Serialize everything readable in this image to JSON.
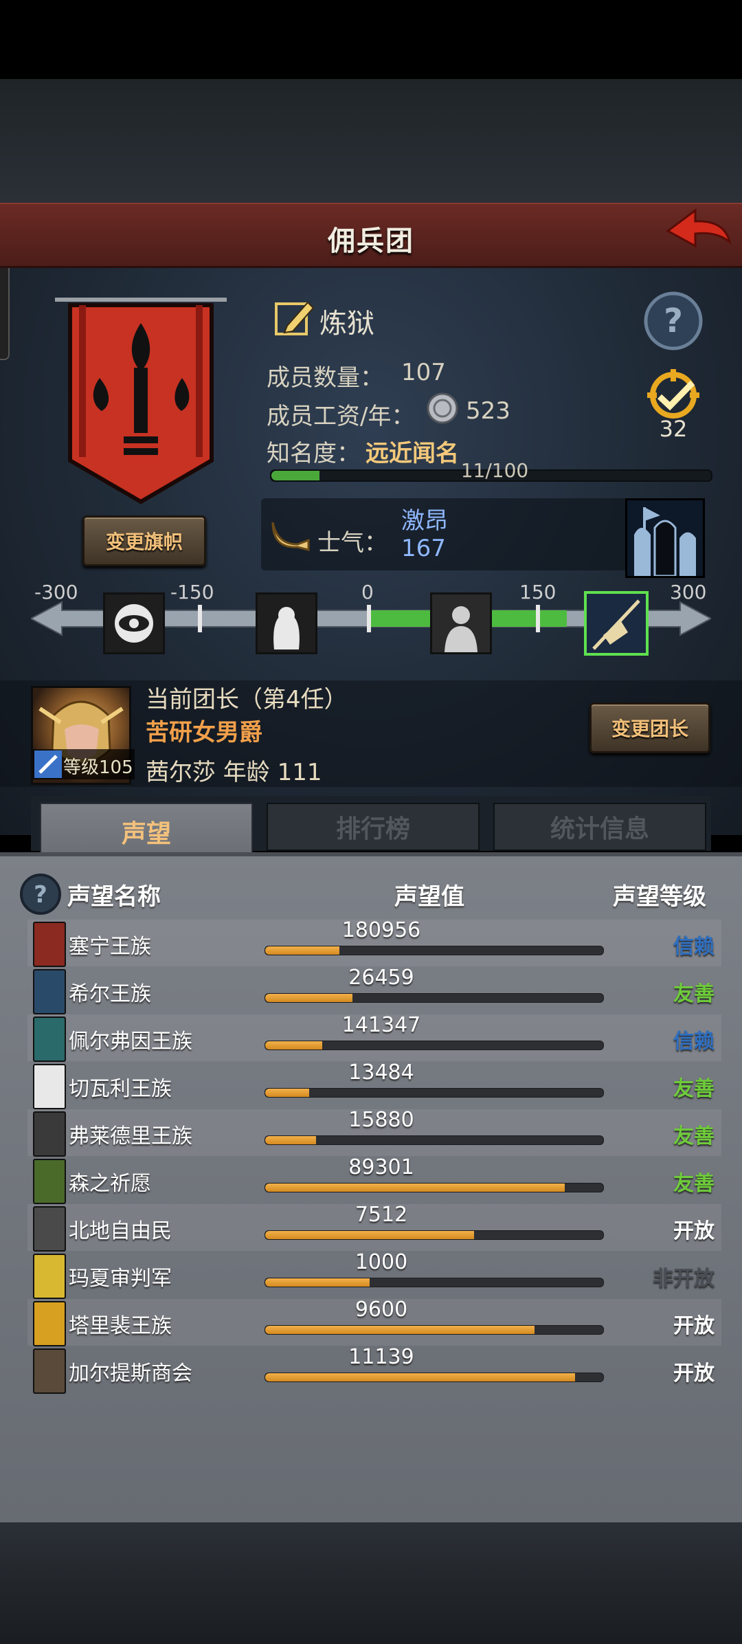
{
  "header": {
    "title": "佣兵团"
  },
  "guild": {
    "name": "炼狱",
    "members_label": "成员数量：",
    "members_value": "107",
    "wage_label": "成员工资/年：",
    "wage_value": "523",
    "fame_label": "知名度：",
    "fame_value": "远近闻名",
    "fame_progress_text": "11/100",
    "fame_progress_fraction": 0.11,
    "target_count": "32",
    "change_banner_label": "变更旗帜",
    "morale_label": "士气：",
    "morale_state": "激昂",
    "morale_value": "167"
  },
  "morale_scale": {
    "ticks": [
      "-300",
      "-150",
      "0",
      "150",
      "300"
    ],
    "value": 167,
    "range": [
      -300,
      300
    ]
  },
  "leader": {
    "title": "当前团长（第4任）",
    "trait": "苦研女男爵",
    "level_label": "等级105",
    "name_age": "茜尔莎  年龄  111",
    "change_label": "变更团长"
  },
  "tabs": [
    "声望",
    "排行榜",
    "统计信息"
  ],
  "reputation": {
    "headers": {
      "name": "声望名称",
      "value": "声望值",
      "level": "声望等级"
    },
    "rows": [
      {
        "name": "塞宁王族",
        "value": "180956",
        "level": "信赖",
        "fill": 0.22,
        "crest": "#8a2a20"
      },
      {
        "name": "希尔王族",
        "value": "26459",
        "level": "友善",
        "fill": 0.26,
        "crest": "#2a4a6a"
      },
      {
        "name": "佩尔弗因王族",
        "value": "141347",
        "level": "信赖",
        "fill": 0.17,
        "crest": "#2a6a6a"
      },
      {
        "name": "切瓦利王族",
        "value": "13484",
        "level": "友善",
        "fill": 0.13,
        "crest": "#e8e8e8"
      },
      {
        "name": "弗莱德里王族",
        "value": "15880",
        "level": "友善",
        "fill": 0.15,
        "crest": "#3a3a3a"
      },
      {
        "name": "森之祈愿",
        "value": "89301",
        "level": "友善",
        "fill": 0.89,
        "crest": "#4a6a2a"
      },
      {
        "name": "北地自由民",
        "value": "7512",
        "level": "开放",
        "fill": 0.62,
        "crest": "#4a4a4a"
      },
      {
        "name": "玛夏审判军",
        "value": "1000",
        "level": "非开放",
        "fill": 0.31,
        "crest": "#d8b830"
      },
      {
        "name": "塔里裴王族",
        "value": "9600",
        "level": "开放",
        "fill": 0.8,
        "crest": "#d8a020"
      },
      {
        "name": "加尔提斯商会",
        "value": "11139",
        "level": "开放",
        "fill": 0.92,
        "crest": "#5a4a3a"
      }
    ],
    "level_colors": {
      "信赖": "#2f6fc0",
      "友善": "#6ecb3a",
      "开放": "#ffffff",
      "非开放": "#4a4e55"
    }
  }
}
